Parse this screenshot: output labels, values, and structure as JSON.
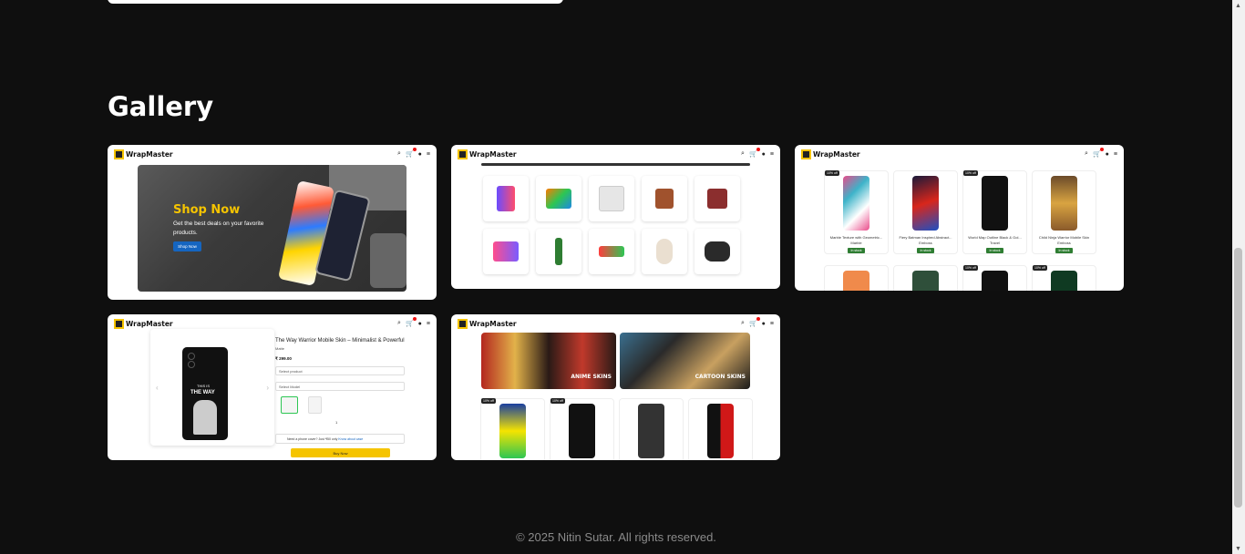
{
  "gallery": {
    "title": "Gallery"
  },
  "mockup": {
    "brand": "WrapMaster",
    "hero_title": "Shop Now",
    "hero_text": "Get the best deals on your favorite products.",
    "hero_button": "Shop Now",
    "products": [
      {
        "name": "Marble Texture with Geometric...",
        "category": "Marble",
        "badge": "In stock",
        "off": "10% off"
      },
      {
        "name": "Fiery Batman Inspired Abstract...",
        "category": "Emboss",
        "badge": "In stock",
        "off": ""
      },
      {
        "name": "World Map Outline Black & Gol...",
        "category": "Travel",
        "badge": "In stock",
        "off": "10% off"
      },
      {
        "name": "Child Ninja Warrior Mobile Skin",
        "category": "Emboss",
        "badge": "In stock",
        "off": ""
      }
    ],
    "detail": {
      "title": "The Way Warrior Mobile Skin – Minimalist & Powerful",
      "sub": "Matte",
      "price": "₹ 299.00",
      "select_product": "Select product",
      "select_model": "Select Model",
      "qty": "1",
      "phone_cover": "Need a phone cover? Just ₹50 only",
      "know_more": "Know about case",
      "buy": "Buy Now",
      "phone_text_1": "THIS IS",
      "phone_text_2": "THE WAY"
    },
    "banners": [
      "ANIME SKINS",
      "CARTOON SKINS"
    ],
    "off_tag": "10% off"
  },
  "footer": {
    "text": "© 2025 Nitin Sutar. All rights reserved."
  },
  "colors": {
    "background": "#0f0f0f",
    "accent_yellow": "#f5c400",
    "button_blue": "#1565c0"
  }
}
